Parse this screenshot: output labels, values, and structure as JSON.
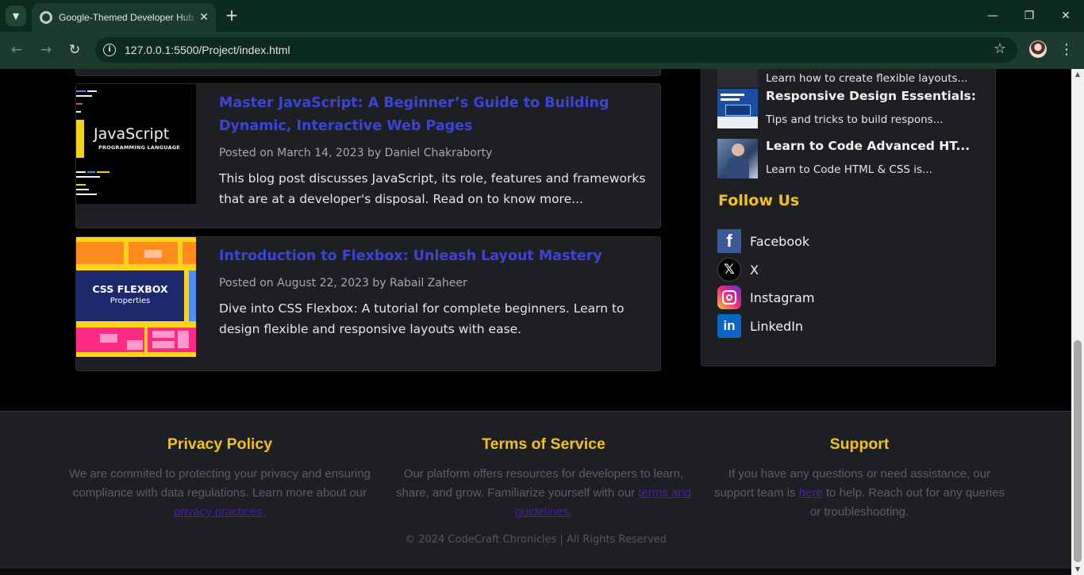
{
  "browser": {
    "tab_title": "Google-Themed Developer Hub",
    "url": "127.0.0.1:5500/Project/index.html"
  },
  "posts": [
    {
      "title": "Master JavaScript: A Beginner’s Guide to Building Dynamic, Interactive Web Pages",
      "meta": "Posted on March 14, 2023 by Daniel Chakraborty",
      "excerpt": "This blog post discusses JavaScript, its role, features and frameworks that are at a developer's disposal. Read on to know more...",
      "thumb_title": "JavaScript",
      "thumb_sub": "PROGRAMMING LANGUAGE"
    },
    {
      "title": "Introduction to Flexbox: Unleash Layout Mastery",
      "meta": "Posted on August 22, 2023 by Rabail Zaheer",
      "excerpt": "Dive into CSS Flexbox: A tutorial for complete beginners. Learn to design flexible and responsive layouts with ease.",
      "thumb_title": "CSS FLEXBOX",
      "thumb_sub": "Properties"
    }
  ],
  "sidebar": {
    "recent": [
      {
        "title": "",
        "desc": "Learn how to create flexible layouts..."
      },
      {
        "title": "Responsive Design Essentials:",
        "desc": "Tips and tricks to build respons..."
      },
      {
        "title": "Learn to Code Advanced HT...",
        "desc": "Learn to Code HTML & CSS is..."
      }
    ],
    "follow_heading": "Follow Us",
    "social": [
      {
        "label": "Facebook",
        "icon": "facebook-icon"
      },
      {
        "label": "X",
        "icon": "x-icon"
      },
      {
        "label": "Instagram",
        "icon": "instagram-icon"
      },
      {
        "label": "LinkedIn",
        "icon": "linkedin-icon"
      }
    ]
  },
  "footer": {
    "privacy": {
      "heading": "Privacy Policy",
      "text": "We are commited to protecting your privacy and ensuring compliance with data regulations. Learn more about our",
      "link": "privacy practices."
    },
    "terms": {
      "heading": "Terms of Service",
      "text": "Our platform offers resources for developers to learn, share, and grow. Familiarize yourself with our",
      "link": "terms and guidelines."
    },
    "support": {
      "heading": "Support",
      "text_before": "If you have any questions or need assistance, our support team is",
      "link": "here",
      "text_after": "to help. Reach out for any queries or troubleshooting."
    },
    "copyright": "© 2024 CodeCraft Chronicles | All Rights Reserved"
  },
  "colors": {
    "accent_yellow": "#f1c21b",
    "post_title_blue": "#3c44d4",
    "link_purple": "#4b1ea8"
  }
}
